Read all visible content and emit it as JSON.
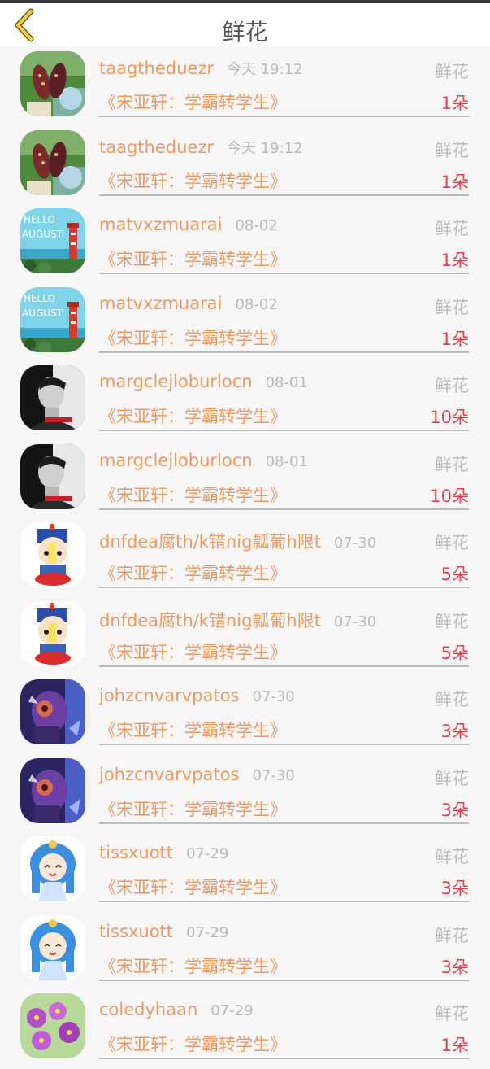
{
  "header": {
    "title": "鲜花"
  },
  "items": [
    {
      "avatar": "avatar-feet-beach",
      "name": "taagtheduezr",
      "time": "今天 19:12",
      "type": "鲜花",
      "book": "《宋亚轩：学霸转学生》",
      "count": "1朵"
    },
    {
      "avatar": "avatar-feet-beach",
      "name": "taagtheduezr",
      "time": "今天 19:12",
      "type": "鲜花",
      "book": "《宋亚轩：学霸转学生》",
      "count": "1朵"
    },
    {
      "avatar": "avatar-lighthouse",
      "name": "matvxzmuarai",
      "time": "08-02",
      "type": "鲜花",
      "book": "《宋亚轩：学霸转学生》",
      "count": "1朵"
    },
    {
      "avatar": "avatar-lighthouse",
      "name": "matvxzmuarai",
      "time": "08-02",
      "type": "鲜花",
      "book": "《宋亚轩：学霸转学生》",
      "count": "1朵"
    },
    {
      "avatar": "avatar-man-portrait",
      "name": "margclejloburlocn",
      "time": "08-01",
      "type": "鲜花",
      "book": "《宋亚轩：学霸转学生》",
      "count": "10朵"
    },
    {
      "avatar": "avatar-man-portrait",
      "name": "margclejloburlocn",
      "time": "08-01",
      "type": "鲜花",
      "book": "《宋亚轩：学霸转学生》",
      "count": "10朵"
    },
    {
      "avatar": "avatar-cartoon-jiangshi",
      "name": "dnfdea腐th/k错nig瓢葡h限t",
      "time": "07-30",
      "type": "鲜花",
      "book": "《宋亚轩：学霸转学生》",
      "count": "5朵"
    },
    {
      "avatar": "avatar-cartoon-jiangshi",
      "name": "dnfdea腐th/k错nig瓢葡h限t",
      "time": "07-30",
      "type": "鲜花",
      "book": "《宋亚轩：学霸转学生》",
      "count": "5朵"
    },
    {
      "avatar": "avatar-game-character",
      "name": "johzcnvarvpatos",
      "time": "07-30",
      "type": "鲜花",
      "book": "《宋亚轩：学霸转学生》",
      "count": "3朵"
    },
    {
      "avatar": "avatar-game-character",
      "name": "johzcnvarvpatos",
      "time": "07-30",
      "type": "鲜花",
      "book": "《宋亚轩：学霸转学生》",
      "count": "3朵"
    },
    {
      "avatar": "avatar-anime-girl-blue",
      "name": "tissxuott",
      "time": "07-29",
      "type": "鲜花",
      "book": "《宋亚轩：学霸转学生》",
      "count": "3朵"
    },
    {
      "avatar": "avatar-anime-girl-blue",
      "name": "tissxuott",
      "time": "07-29",
      "type": "鲜花",
      "book": "《宋亚轩：学霸转学生》",
      "count": "3朵"
    },
    {
      "avatar": "avatar-purple-flowers",
      "name": "coledyhaan",
      "time": "07-29",
      "type": "鲜花",
      "book": "《宋亚轩：学霸转学生》",
      "count": "1朵"
    }
  ]
}
